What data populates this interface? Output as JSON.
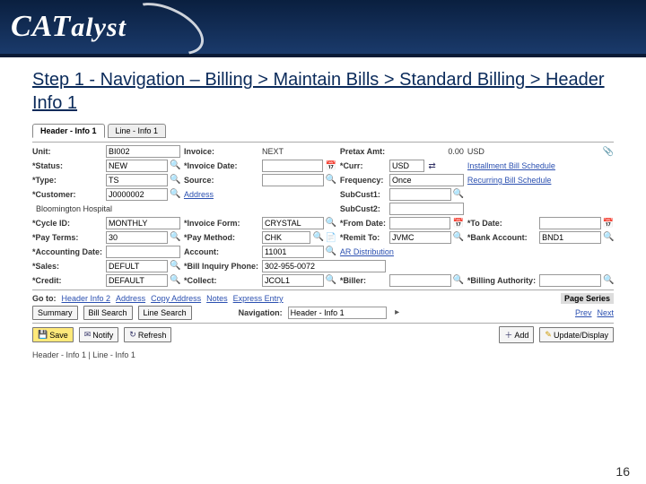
{
  "page_number": "16",
  "brand": "CATalyst",
  "title": "Step 1 - Navigation – Billing > Maintain Bills > Standard Billing > Header Info 1",
  "tabs": {
    "header": "Header - Info 1",
    "line": "Line - Info 1"
  },
  "labels": {
    "unit": "Unit:",
    "invoice": "Invoice:",
    "pretax": "Pretax Amt:",
    "status": "Status:",
    "invoice_date": "Invoice Date:",
    "curr": "Curr:",
    "type": "Type:",
    "source": "Source:",
    "frequency": "Frequency:",
    "customer": "Customer:",
    "subcust1": "SubCust1:",
    "subcust2": "SubCust2:",
    "cycle_id": "Cycle ID:",
    "invoice_form": "Invoice Form:",
    "from_date": "From Date:",
    "to_date": "To Date:",
    "pay_terms": "Pay Terms:",
    "pay_method": "Pay Method:",
    "remit_to": "Remit To:",
    "bank_acct": "Bank Account:",
    "acct_date": "Accounting Date:",
    "account": "Account:",
    "sales": "Sales:",
    "inquiry_phone": "Bill Inquiry Phone:",
    "credit": "Credit:",
    "collect": "Collect:",
    "biller": "Biller:",
    "bill_auth": "Billing Authority:",
    "goto": "Go to:",
    "navigation": "Navigation:",
    "page_series": "Page Series"
  },
  "values": {
    "unit": "BI002",
    "invoice": "NEXT",
    "pretax": "0.00",
    "pretax_curr": "USD",
    "status": "NEW",
    "curr": "USD",
    "type": "TS",
    "frequency": "Once",
    "customer": "J0000002",
    "customer_name": "Bloomington Hospital",
    "cycle_id": "MONTHLY",
    "invoice_form": "CRYSTAL",
    "pay_terms": "30",
    "pay_method": "CHK",
    "remit_to": "JVMC",
    "bank_acct": "BND1",
    "account": "11001",
    "ar_dist": "AR Distribution",
    "sales": "DEFULT",
    "inquiry_phone": "302-955-0072",
    "credit": "DEFAULT",
    "collect": "JCOL1",
    "navigation": "Header - Info 1"
  },
  "links": {
    "address": "Address",
    "installment": "Installment Bill Schedule",
    "recurring": "Recurring Bill Schedule",
    "goto_header2": "Header Info 2",
    "goto_addr": "Address",
    "goto_copy": "Copy Address",
    "goto_notes": "Notes",
    "goto_express": "Express Entry",
    "goto_prev": "Prev",
    "goto_next": "Next"
  },
  "buttons": {
    "summary": "Summary",
    "bill_search": "Bill Search",
    "line_search": "Line Search",
    "save": "Save",
    "notify": "Notify",
    "refresh": "Refresh",
    "add": "Add",
    "update": "Update/Display"
  },
  "breadcrumb": "Header - Info 1 | Line - Info 1"
}
